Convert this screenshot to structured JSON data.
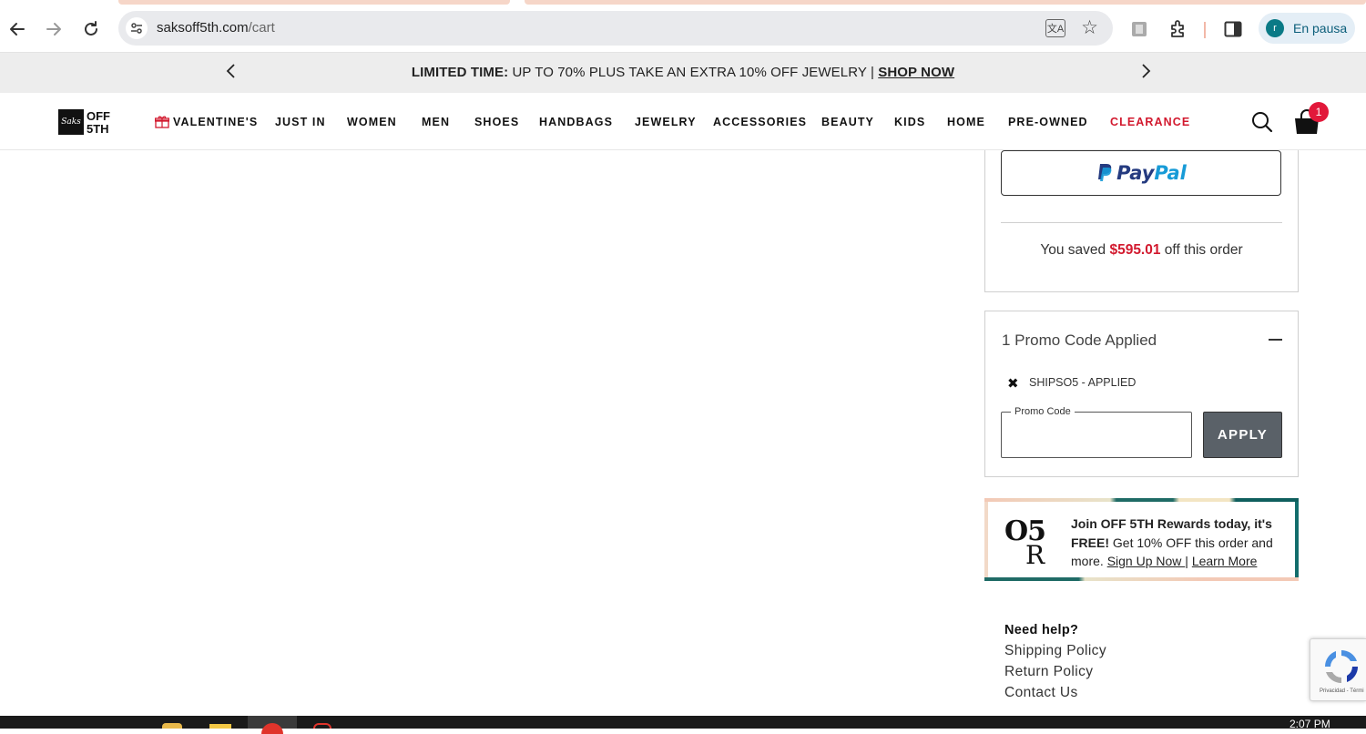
{
  "browser": {
    "url_host": "saksoff5th.com",
    "url_path": "/cart",
    "profile_initial": "r",
    "profile_status": "En pausa"
  },
  "banner": {
    "bold": "LIMITED TIME:",
    "text": " UP TO 70% PLUS TAKE AN EXTRA 10% OFF JEWELRY | ",
    "link": "SHOP NOW"
  },
  "header": {
    "logo_top": "OFF",
    "logo_bottom": "5TH",
    "logo_box": "Saks",
    "nav": [
      "VALENTINE'S",
      "JUST IN",
      "WOMEN",
      "MEN",
      "SHOES",
      "HANDBAGS",
      "JEWELRY",
      "ACCESSORIES",
      "BEAUTY",
      "KIDS",
      "HOME",
      "PRE-OWNED",
      "CLEARANCE"
    ],
    "cart_count": "1"
  },
  "summary": {
    "paypal_part1": "Pay",
    "paypal_part2": "Pal",
    "saved_prefix": "You saved ",
    "saved_amount": "$595.01",
    "saved_suffix": " off this order"
  },
  "promo": {
    "title": "1 Promo Code Applied",
    "applied_code": "SHIPSO5 - APPLIED",
    "field_label": "Promo Code",
    "field_value": "",
    "apply_label": "APPLY"
  },
  "rewards": {
    "logo_top": "O5",
    "logo_bottom": "R",
    "text_bold1": "Join OFF 5TH Rewards today, it's",
    "text_bold2": "FREE!",
    "text_body": " Get 10% OFF this order and more. ",
    "link_signup": "Sign Up Now ",
    "separator": " | ",
    "link_learn": "Learn More"
  },
  "help": {
    "title": "Need help?",
    "links": [
      "Shipping Policy",
      "Return Policy",
      "Contact Us"
    ]
  },
  "recaptcha": {
    "text": "Privacidad - Térmi"
  },
  "taskbar": {
    "clock": "2:07 PM"
  },
  "colors": {
    "accent_red": "#d2192e",
    "paypal_dark": "#253b80",
    "paypal_light": "#179bd7",
    "apply_gray": "#5a6168"
  }
}
